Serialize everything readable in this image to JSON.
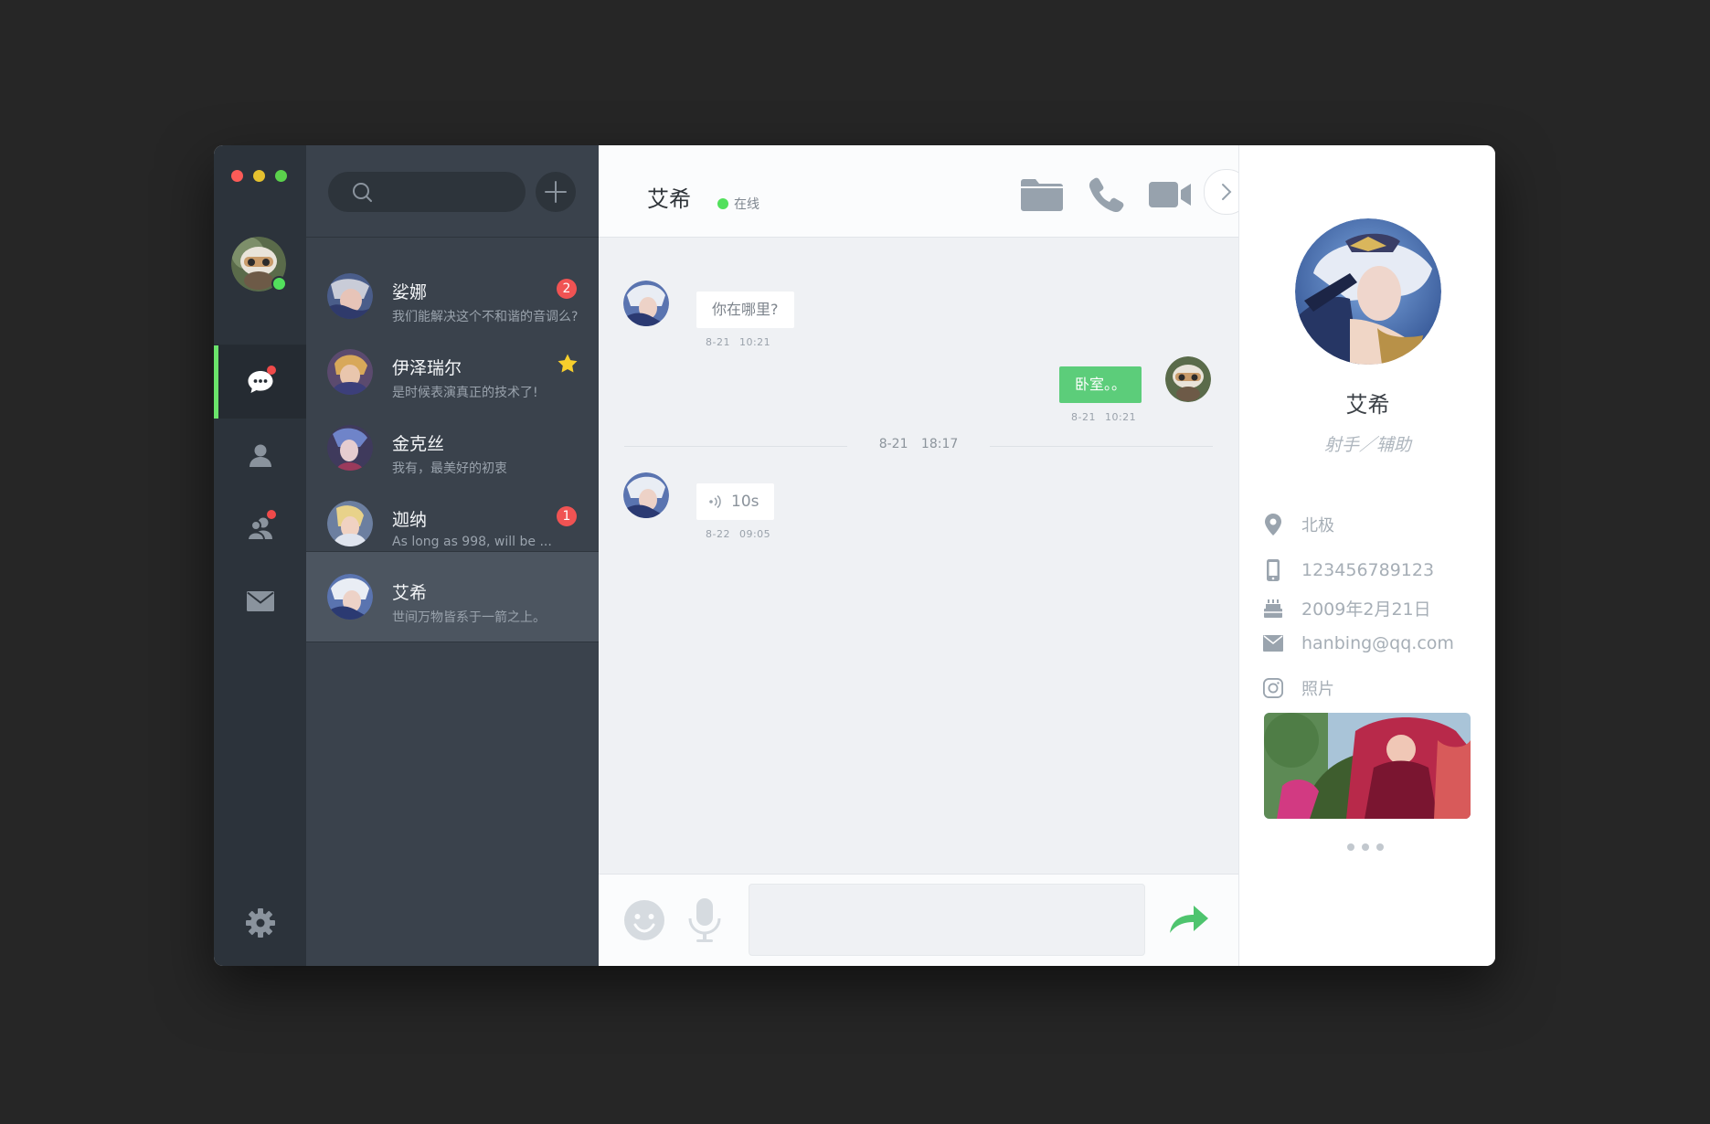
{
  "colors": {
    "accent": "#6be36b",
    "badge": "#f04a4a",
    "bubble_out": "#5ccd7a",
    "rail": "#2c333b",
    "list": "#3a424c"
  },
  "window_controls": [
    "close",
    "minimize",
    "zoom"
  ],
  "rail": {
    "items": [
      {
        "icon": "chat-icon",
        "active": true,
        "dot": true
      },
      {
        "icon": "contact-icon",
        "active": false,
        "dot": false
      },
      {
        "icon": "group-icon",
        "active": false,
        "dot": true
      },
      {
        "icon": "mail-icon",
        "active": false,
        "dot": false
      }
    ],
    "settings_icon": "gear-icon"
  },
  "search": {
    "placeholder": ""
  },
  "conversations": [
    {
      "name": "娑娜",
      "preview": "我们能解决这个不和谐的音调么?",
      "badge": "2"
    },
    {
      "name": "伊泽瑞尔",
      "preview": "是时候表演真正的技术了!",
      "star": true
    },
    {
      "name": "金克丝",
      "preview": "我有，最美好的初衷"
    },
    {
      "name": "迦纳",
      "preview": "As long as 998, will be ...",
      "badge": "1"
    },
    {
      "name": "艾希",
      "preview": "世间万物皆系于一箭之上。",
      "active": true
    }
  ],
  "chat": {
    "title": "艾希",
    "status": "在线",
    "header_icons": [
      "folder-icon",
      "phone-icon",
      "video-icon"
    ],
    "messages": [
      {
        "direction": "in",
        "text": "你在哪里?",
        "meta": "8-21 10:21"
      },
      {
        "direction": "out",
        "text": "卧室。。",
        "meta": "8-21 10:21"
      },
      {
        "direction": "in",
        "voice": "10s",
        "meta": "8-22 09:05"
      }
    ],
    "divider": "8-21 18:17",
    "composer": {
      "placeholder": ""
    }
  },
  "profile": {
    "name": "艾希",
    "role": "射手／辅助",
    "location": "北极",
    "phone": "123456789123",
    "birthday": "2009年2月21日",
    "email": "hanbing@qq.com",
    "photos_label": "照片"
  }
}
